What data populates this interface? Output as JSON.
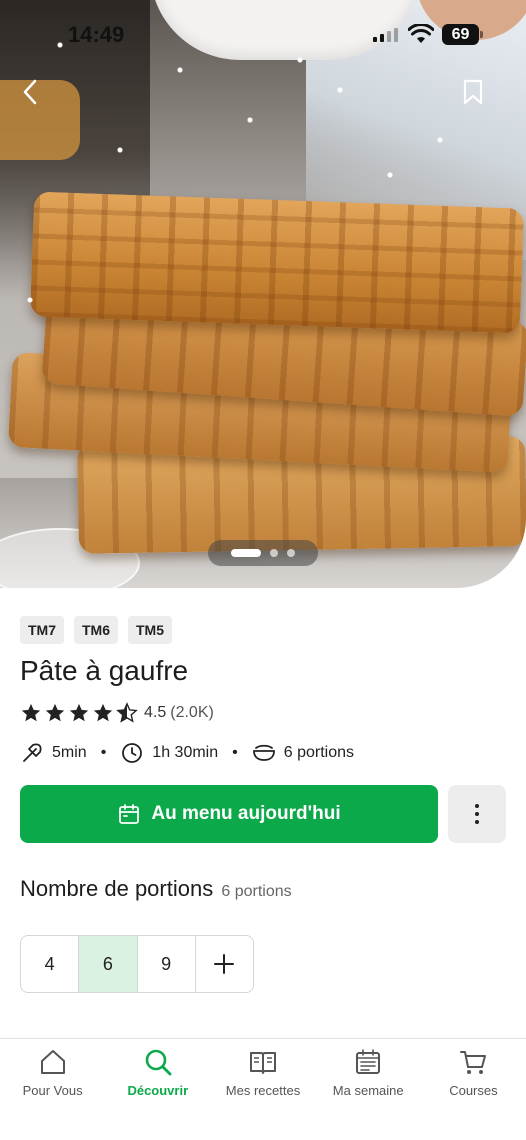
{
  "status_bar": {
    "time": "14:49",
    "battery": "69"
  },
  "hero": {
    "carousel": {
      "count": 3,
      "active_index": 0
    }
  },
  "thermomix_chips": [
    "TM7",
    "TM6",
    "TM5"
  ],
  "recipe": {
    "title": "Pâte à gaufre",
    "rating": 4.5,
    "rating_value": "4.5",
    "rating_count": "(2.0K)",
    "prep_time": "5min",
    "total_time": "1h 30min",
    "portions": "6 portions"
  },
  "actions": {
    "add_to_menu_label": "Au menu aujourd'hui"
  },
  "portions_selector": {
    "heading": "Nombre de portions",
    "current": "6 portions",
    "options": [
      "4",
      "6",
      "9"
    ],
    "selected": "6",
    "plus": "+"
  },
  "bottom_nav": {
    "items": [
      {
        "label": "Pour Vous",
        "icon": "home-icon"
      },
      {
        "label": "Découvrir",
        "icon": "search-icon",
        "active": true
      },
      {
        "label": "Mes recettes",
        "icon": "book-icon"
      },
      {
        "label": "Ma semaine",
        "icon": "calendar-icon"
      },
      {
        "label": "Courses",
        "icon": "cart-icon"
      }
    ]
  },
  "colors": {
    "accent": "#0ca94a",
    "selected_bg": "#d9f2e2",
    "chip_bg": "#ededed"
  }
}
